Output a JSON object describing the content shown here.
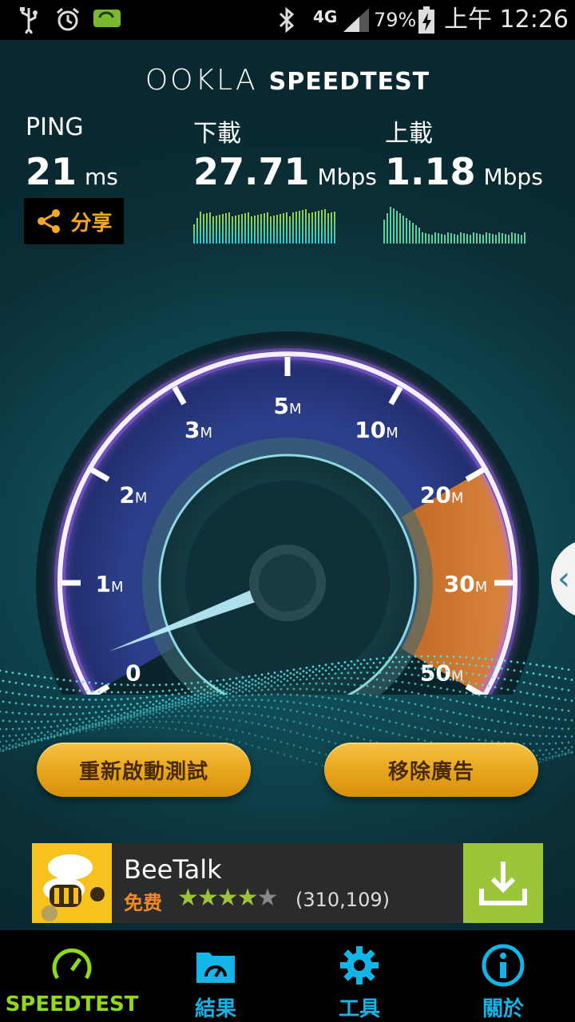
{
  "status_bar": {
    "network": "4G",
    "battery": "79%",
    "time": "上午 12:26",
    "icons": [
      "usb-icon",
      "alarm-icon",
      "battery-saver-icon",
      "bluetooth-icon",
      "signal-icon",
      "charging-icon"
    ]
  },
  "brand": {
    "ookla": "OOKLA",
    "speedtest": "SPEEDTEST"
  },
  "metrics": {
    "ping": {
      "label": "PING",
      "value": "21",
      "unit": "ms"
    },
    "download": {
      "label": "下載",
      "value": "27.71",
      "unit": "Mbps"
    },
    "upload": {
      "label": "上載",
      "value": "1.18",
      "unit": "Mbps"
    }
  },
  "share_label": "分享",
  "gauge": {
    "labels": [
      "0",
      "1",
      "2",
      "3",
      "5",
      "10",
      "20",
      "30",
      "50"
    ],
    "unit": "M",
    "needle_value": 0.3
  },
  "buttons": {
    "restart": "重新啟動測試",
    "remove_ads": "移除廣告"
  },
  "ad": {
    "title": "BeeTalk",
    "price": "免费",
    "rating": 4.5,
    "stars": "★★★★",
    "empty_star": "★",
    "reviews": "(310,109)"
  },
  "nav": {
    "speedtest": "SPEEDTEST",
    "results": "結果",
    "tools": "工具",
    "about": "關於"
  },
  "colors": {
    "accent_orange": "#f5a623",
    "nav_active": "#8fd81a",
    "nav_icon": "#13b5e8",
    "graph_green": "#8ed146",
    "graph_cyan": "#31c9d8"
  }
}
